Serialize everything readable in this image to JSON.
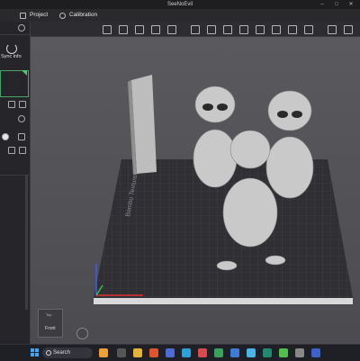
{
  "window": {
    "title": "SeeNoEvil"
  },
  "menu": {
    "items": [
      {
        "label": "Project"
      },
      {
        "label": "Calibration"
      }
    ]
  },
  "sidebar": {
    "sync_label": "Sync info"
  },
  "viewport": {
    "bed_text": "Bambu Textured PEI Plate",
    "nav_cube": {
      "front": "Front",
      "top": "Top"
    }
  },
  "taskbar": {
    "search_label": "Search"
  },
  "colors": {
    "accent_green": "#4ccc6b",
    "bed": "#2f2f34",
    "model": "#c9c9c9"
  }
}
